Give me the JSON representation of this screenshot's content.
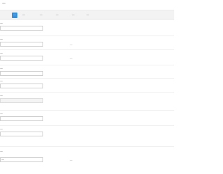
{
  "header": {
    "title": "—"
  },
  "tabs": [
    {
      "label": "—",
      "active": true
    },
    {
      "label": "—",
      "active": false
    },
    {
      "label": "—",
      "active": false
    },
    {
      "label": "—",
      "active": false
    },
    {
      "label": "—",
      "active": false
    },
    {
      "label": "—",
      "active": false,
      "special": true
    }
  ],
  "fields": [
    {
      "label": "—",
      "value": "",
      "disabled": false,
      "hint": ""
    },
    {
      "label": "—",
      "value": "",
      "disabled": false,
      "hint": "—"
    },
    {
      "label": "—",
      "value": "",
      "disabled": false,
      "hint": "—"
    },
    {
      "label": "—",
      "value": "",
      "disabled": false,
      "hint": ""
    },
    {
      "label": "—",
      "value": "",
      "disabled": false,
      "hint": ""
    },
    {
      "label": "—",
      "value": "",
      "disabled": true,
      "hint": ""
    },
    {
      "label": "—",
      "value": "",
      "disabled": false,
      "hint": ""
    },
    {
      "label": "—",
      "value": "",
      "disabled": false,
      "hint": ""
    },
    {
      "label": "—",
      "value": "—",
      "disabled": false,
      "hint": "—"
    }
  ],
  "colors": {
    "accent": "#3b8fd6",
    "special": "#d9342b"
  }
}
